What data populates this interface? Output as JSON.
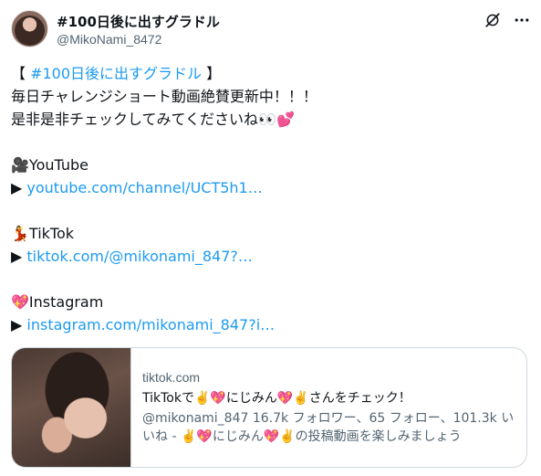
{
  "author": {
    "name": "#100日後に出すグラドル",
    "handle": "@MikoNami_8472"
  },
  "tweet": {
    "lines": [
      {
        "pre": "【 ",
        "hashtag": "#100日後に出すグラドル",
        "post": " 】"
      },
      "毎日チャレンジショート動画絶賛更新中！！！",
      "是非是非チェックしてみてくださいね👀💕"
    ],
    "youtube": {
      "label": "🎥YouTube",
      "arrow": "▶",
      "link": "youtube.com/channel/UCT5h1…"
    },
    "tiktok": {
      "label": "💃TikTok",
      "arrow": "▶",
      "link": "tiktok.com/@mikonami_847?…"
    },
    "instagram": {
      "label": "💖Instagram",
      "arrow": "▶",
      "link": "instagram.com/mikonami_847?i…"
    }
  },
  "card": {
    "domain": "tiktok.com",
    "title": "TikTokで✌️💖にじみん💖✌️さんをチェック！",
    "description": "@mikonami_847 16.7k フォロワー、65 フォロー、101.3k いいね - ✌️💖にじみん💖✌️の投稿動画を楽しみましょう"
  },
  "icons": {
    "grok": "grok-icon",
    "more": "more-icon"
  },
  "colors": {
    "link": "#1d9bf0",
    "secondary_text": "#536471",
    "border": "#cfd9de"
  }
}
